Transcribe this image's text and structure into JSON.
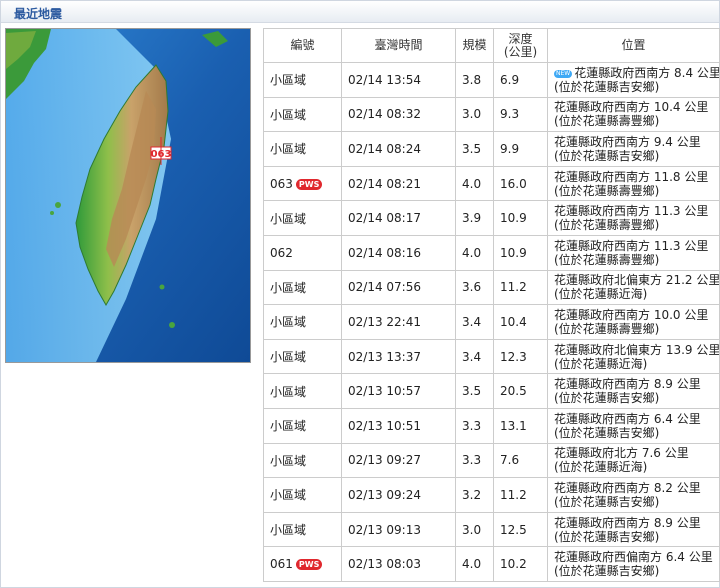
{
  "header": {
    "title": "最近地震"
  },
  "map": {
    "marker_label": "063",
    "icon": "earthquake-location-marker"
  },
  "table": {
    "columns": [
      "編號",
      "臺灣時間",
      "規模",
      "深度(公里)",
      "位置"
    ],
    "depth_header_line1": "深度",
    "depth_header_line2": "(公里)",
    "rows": [
      {
        "id": "小區域",
        "pws": "",
        "time": "02/14 13:54",
        "mag": "3.8",
        "depth": "6.9",
        "new": "NEW",
        "loc1": "花蓮縣政府西南方 8.4 公里",
        "loc2": "(位於花蓮縣吉安鄉)"
      },
      {
        "id": "小區域",
        "pws": "",
        "time": "02/14 08:32",
        "mag": "3.0",
        "depth": "9.3",
        "new": "",
        "loc1": "花蓮縣政府西南方 10.4 公里",
        "loc2": "(位於花蓮縣壽豐鄉)"
      },
      {
        "id": "小區域",
        "pws": "",
        "time": "02/14 08:24",
        "mag": "3.5",
        "depth": "9.9",
        "new": "",
        "loc1": "花蓮縣政府西南方 9.4 公里",
        "loc2": "(位於花蓮縣吉安鄉)"
      },
      {
        "id": "063",
        "pws": "PWS",
        "time": "02/14 08:21",
        "mag": "4.0",
        "depth": "16.0",
        "new": "",
        "loc1": "花蓮縣政府西南方 11.8 公里",
        "loc2": "(位於花蓮縣壽豐鄉)"
      },
      {
        "id": "小區域",
        "pws": "",
        "time": "02/14 08:17",
        "mag": "3.9",
        "depth": "10.9",
        "new": "",
        "loc1": "花蓮縣政府西南方 11.3 公里",
        "loc2": "(位於花蓮縣壽豐鄉)"
      },
      {
        "id": "062",
        "pws": "",
        "time": "02/14 08:16",
        "mag": "4.0",
        "depth": "10.9",
        "new": "",
        "loc1": "花蓮縣政府西南方 11.3 公里",
        "loc2": "(位於花蓮縣壽豐鄉)"
      },
      {
        "id": "小區域",
        "pws": "",
        "time": "02/14 07:56",
        "mag": "3.6",
        "depth": "11.2",
        "new": "",
        "loc1": "花蓮縣政府北偏東方 21.2 公里",
        "loc2": "(位於花蓮縣近海)"
      },
      {
        "id": "小區域",
        "pws": "",
        "time": "02/13 22:41",
        "mag": "3.4",
        "depth": "10.4",
        "new": "",
        "loc1": "花蓮縣政府西南方 10.0 公里",
        "loc2": "(位於花蓮縣壽豐鄉)"
      },
      {
        "id": "小區域",
        "pws": "",
        "time": "02/13 13:37",
        "mag": "3.4",
        "depth": "12.3",
        "new": "",
        "loc1": "花蓮縣政府北偏東方 13.9 公里",
        "loc2": "(位於花蓮縣近海)"
      },
      {
        "id": "小區域",
        "pws": "",
        "time": "02/13 10:57",
        "mag": "3.5",
        "depth": "20.5",
        "new": "",
        "loc1": "花蓮縣政府西南方 8.9 公里",
        "loc2": "(位於花蓮縣吉安鄉)"
      },
      {
        "id": "小區域",
        "pws": "",
        "time": "02/13 10:51",
        "mag": "3.3",
        "depth": "13.1",
        "new": "",
        "loc1": "花蓮縣政府西南方 6.4 公里",
        "loc2": "(位於花蓮縣吉安鄉)"
      },
      {
        "id": "小區域",
        "pws": "",
        "time": "02/13 09:27",
        "mag": "3.3",
        "depth": "7.6",
        "new": "",
        "loc1": "花蓮縣政府北方 7.6 公里",
        "loc2": "(位於花蓮縣近海)"
      },
      {
        "id": "小區域",
        "pws": "",
        "time": "02/13 09:24",
        "mag": "3.2",
        "depth": "11.2",
        "new": "",
        "loc1": "花蓮縣政府西南方 8.2 公里",
        "loc2": "(位於花蓮縣吉安鄉)"
      },
      {
        "id": "小區域",
        "pws": "",
        "time": "02/13 09:13",
        "mag": "3.0",
        "depth": "12.5",
        "new": "",
        "loc1": "花蓮縣政府西南方 8.9 公里",
        "loc2": "(位於花蓮縣吉安鄉)"
      },
      {
        "id": "061",
        "pws": "PWS",
        "time": "02/13 08:03",
        "mag": "4.0",
        "depth": "10.2",
        "new": "",
        "loc1": "花蓮縣政府西偏南方 6.4 公里",
        "loc2": "(位於花蓮縣吉安鄉)"
      }
    ]
  },
  "colors": {
    "header_text": "#2c5aa0",
    "pws_badge": "#e0282e",
    "new_badge": "#3fa9f5",
    "grid": "#cccccc"
  }
}
